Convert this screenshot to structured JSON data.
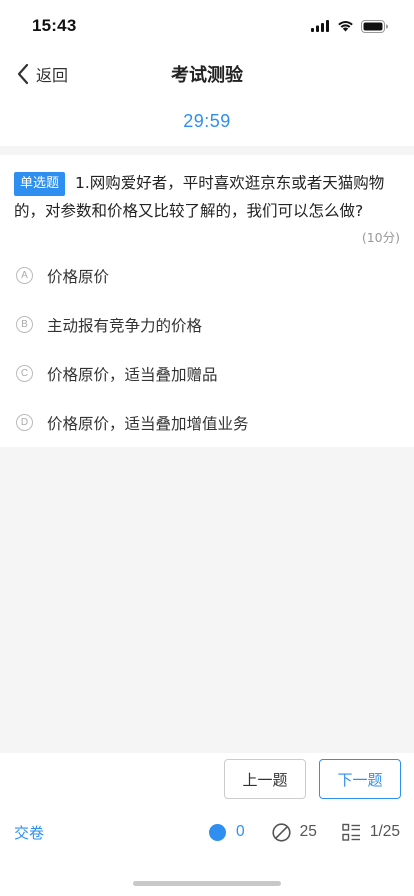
{
  "status_bar": {
    "time": "15:43"
  },
  "nav": {
    "back_label": "返回",
    "title": "考试测验"
  },
  "timer": "29:59",
  "question": {
    "type_badge": "单选题",
    "text": "1.网购爱好者，平时喜欢逛京东或者天猫购物的，对参数和价格又比较了解的，我们可以怎么做?",
    "score": "(10分)",
    "options": [
      {
        "letter": "A",
        "text": "价格原价"
      },
      {
        "letter": "B",
        "text": "主动报有竞争力的价格"
      },
      {
        "letter": "C",
        "text": "价格原价，适当叠加赠品"
      },
      {
        "letter": "D",
        "text": "价格原价，适当叠加增值业务"
      }
    ]
  },
  "buttons": {
    "prev": "上一题",
    "next": "下一题"
  },
  "footer": {
    "submit": "交卷",
    "answered_count": "0",
    "unanswered_count": "25",
    "progress": "1/25"
  },
  "colors": {
    "accent": "#2f8ff0"
  },
  "icons": [
    "signal-icon",
    "wifi-icon",
    "battery-icon",
    "chevron-left-icon",
    "answered-dot-icon",
    "unanswered-icon",
    "list-icon"
  ]
}
